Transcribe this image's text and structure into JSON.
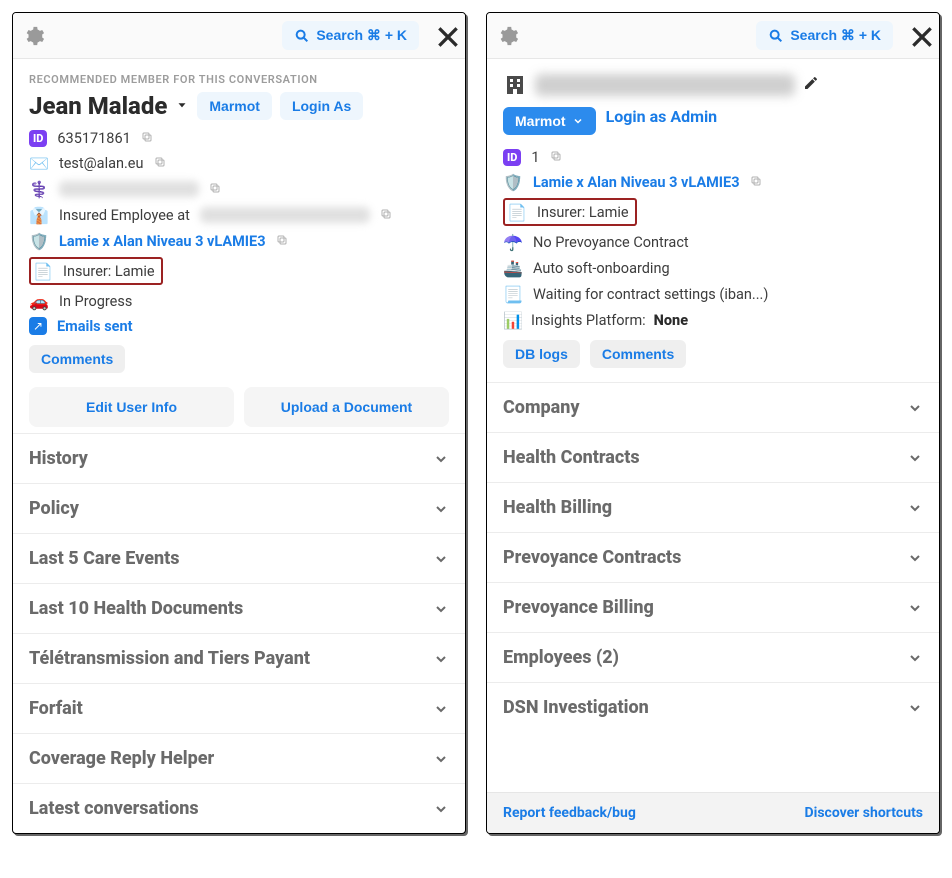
{
  "left": {
    "search_label": "Search ⌘ + K",
    "recommendation": "RECOMMENDED MEMBER FOR THIS CONVERSATION",
    "member_name": "Jean Malade",
    "buttons": {
      "marmot": "Marmot",
      "login_as": "Login As"
    },
    "id_value": "635171861",
    "email": "test@alan.eu",
    "role_prefix": "Insured Employee at",
    "plan": "Lamie x Alan Niveau 3 vLAMIE3",
    "insurer": "Insurer: Lamie",
    "status": "In Progress",
    "emails_sent": "Emails sent",
    "comments": "Comments",
    "edit_user": "Edit User Info",
    "upload_doc": "Upload a Document",
    "sections": [
      "History",
      "Policy",
      "Last 5 Care Events",
      "Last 10 Health Documents",
      "Télétransmission and Tiers Payant",
      "Forfait",
      "Coverage Reply Helper",
      "Latest conversations"
    ]
  },
  "right": {
    "search_label": "Search ⌘ + K",
    "buttons": {
      "marmot": "Marmot",
      "login_admin": "Login as Admin"
    },
    "id_value": "1",
    "plan": "Lamie x Alan Niveau 3 vLAMIE3",
    "insurer": "Insurer: Lamie",
    "no_prevoyance": "No Prevoyance Contract",
    "auto_onboard": "Auto soft-onboarding",
    "contract_wait": "Waiting for contract settings (iban...)",
    "insights_label": "Insights Platform:",
    "insights_value": "None",
    "db_logs": "DB logs",
    "comments": "Comments",
    "sections": [
      "Company",
      "Health Contracts",
      "Health Billing",
      "Prevoyance Contracts",
      "Prevoyance Billing",
      "Employees (2)",
      "DSN Investigation"
    ],
    "footer": {
      "report": "Report feedback/bug",
      "shortcuts": "Discover shortcuts"
    }
  }
}
